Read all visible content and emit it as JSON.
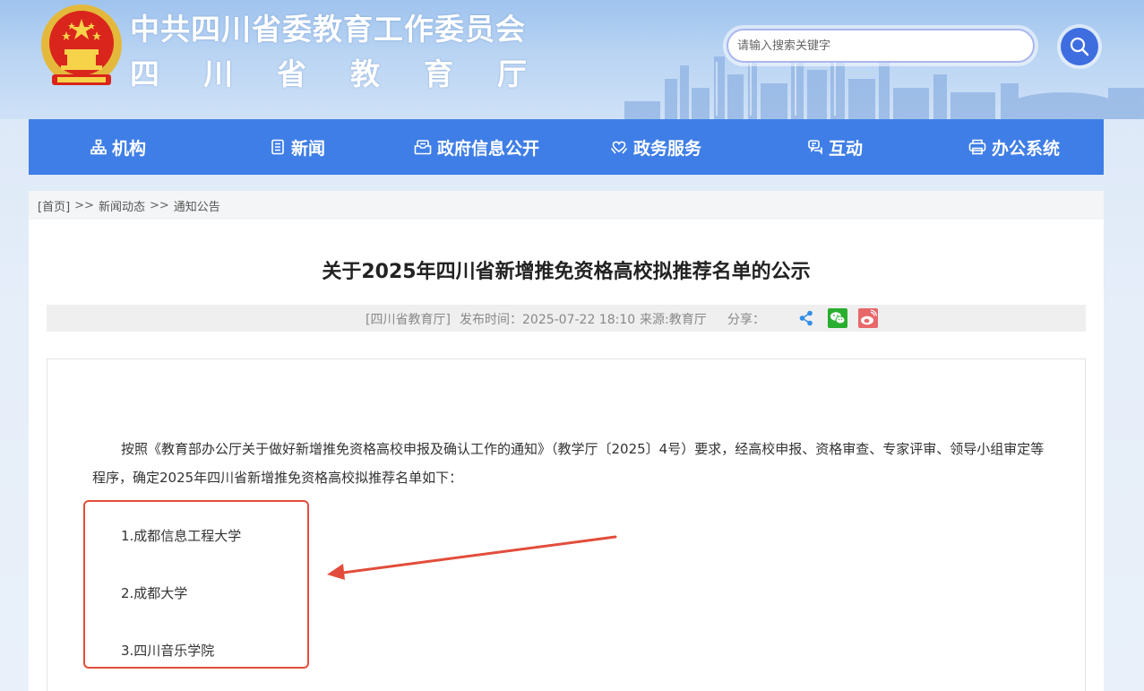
{
  "header": {
    "title_line1": "中共四川省委教育工作委员会",
    "title_line2": "四川省教育厅",
    "search_placeholder": "请输入搜索关键字"
  },
  "nav": {
    "items": [
      {
        "label": "机构",
        "icon": "org-chart-icon"
      },
      {
        "label": "新闻",
        "icon": "news-icon"
      },
      {
        "label": "政府信息公开",
        "icon": "gov-info-icon"
      },
      {
        "label": "政务服务",
        "icon": "heart-hands-icon"
      },
      {
        "label": "互动",
        "icon": "chat-icon"
      },
      {
        "label": "办公系统",
        "icon": "printer-icon"
      }
    ]
  },
  "breadcrumb": {
    "home": "[首页]",
    "sep1": ">>",
    "level1": "新闻动态",
    "sep2": ">>",
    "level2": "通知公告"
  },
  "article": {
    "title": "关于2025年四川省新增推免资格高校拟推荐名单的公示",
    "meta": {
      "department": "[四川省教育厅]",
      "publish_time": "发布时间：2025-07-22 18:10",
      "source": "来源:教育厅",
      "share_label": "分享："
    },
    "paragraph": "按照《教育部办公厅关于做好新增推免资格高校申报及确认工作的通知》（教学厅〔2025〕4号）要求，经高校申报、资格审查、专家评审、领导小组审定等程序，确定2025年四川省新增推免资格高校拟推荐名单如下：",
    "list": [
      "1.成都信息工程大学",
      "2.成都大学",
      "3.四川音乐学院"
    ]
  },
  "colors": {
    "nav_bg": "#3f7ee6",
    "search_button": "#3e6de0",
    "highlight": "#e24d3b",
    "wechat": "#2aae2f",
    "weibo": "#e8686a",
    "share": "#2f8ee8"
  }
}
